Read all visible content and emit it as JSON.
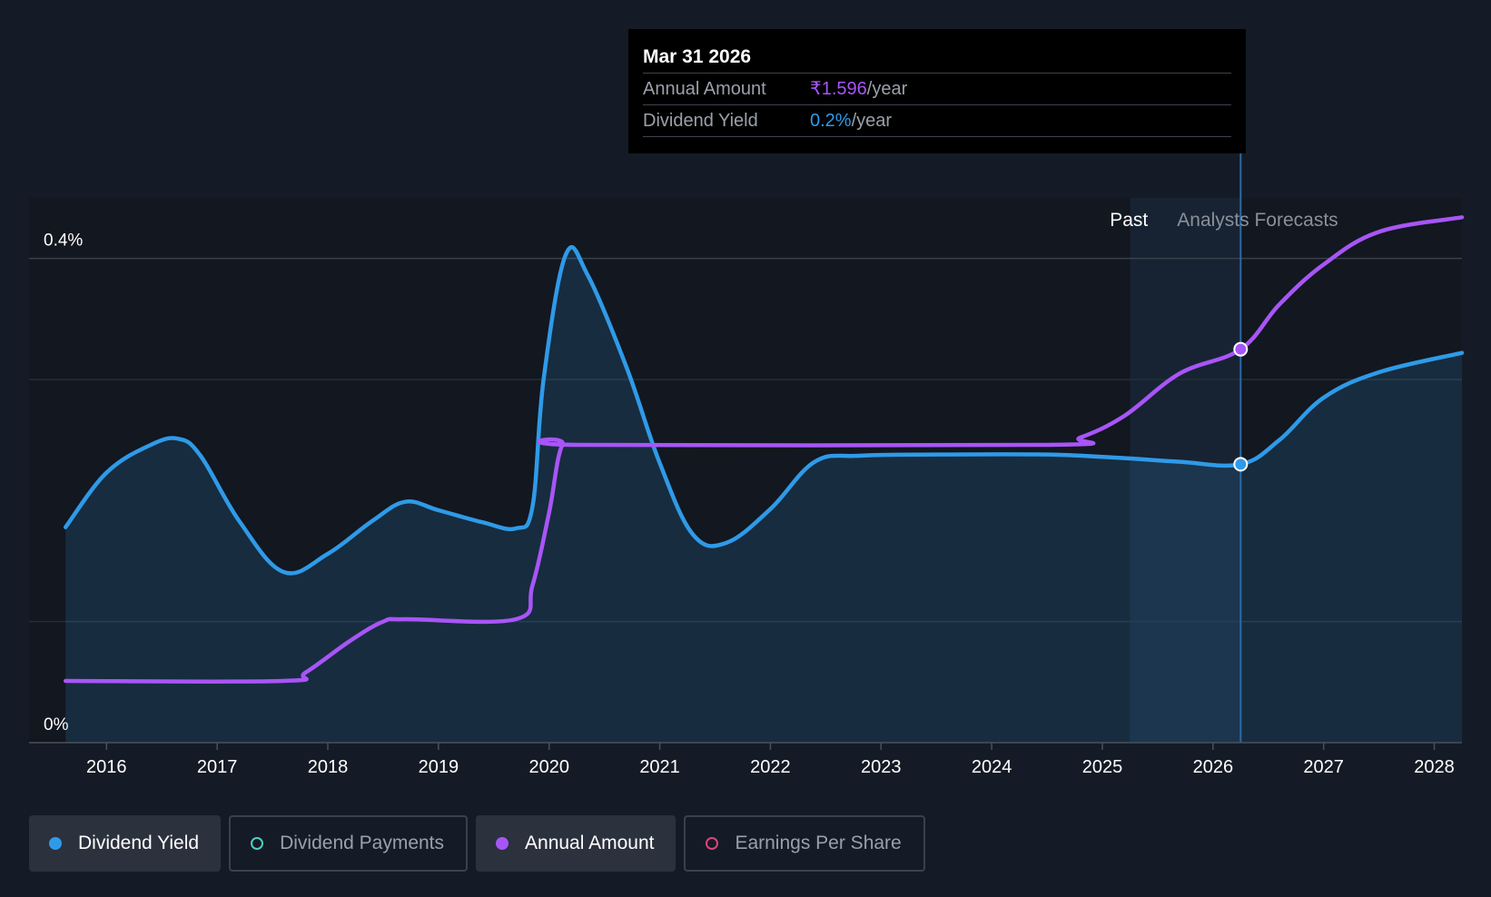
{
  "tooltip": {
    "date": "Mar 31 2026",
    "rows": [
      {
        "label": "Annual Amount",
        "value": "₹1.596",
        "unit": "/year"
      },
      {
        "label": "Dividend Yield",
        "value": "0.2%",
        "unit": "/year"
      }
    ]
  },
  "legend": [
    {
      "label": "Dividend Yield",
      "color": "#2f9ae8",
      "filled": true,
      "active": true
    },
    {
      "label": "Dividend Payments",
      "color": "#4ecdc4",
      "filled": false,
      "active": false
    },
    {
      "label": "Annual Amount",
      "color": "#a855f7",
      "filled": true,
      "active": true
    },
    {
      "label": "Earnings Per Share",
      "color": "#d9467a",
      "filled": false,
      "active": false
    }
  ],
  "chart_data": {
    "type": "line",
    "y_tick_labels": [
      "0%",
      "0.4%"
    ],
    "ylim": [
      0,
      0.45
    ],
    "xlim": [
      2015.3,
      2028.25
    ],
    "x_tick_labels": [
      "2016",
      "2017",
      "2018",
      "2019",
      "2020",
      "2021",
      "2022",
      "2023",
      "2024",
      "2025",
      "2026",
      "2027",
      "2028"
    ],
    "x_ticks": [
      2016,
      2017,
      2018,
      2019,
      2020,
      2021,
      2022,
      2023,
      2024,
      2025,
      2026,
      2027,
      2028
    ],
    "grid": true,
    "regions": [
      {
        "label": "Past",
        "from": 2025.25,
        "to": 2026.25
      },
      {
        "label": "Analysts Forecasts",
        "from": 2026.25,
        "to": 2028.25
      }
    ],
    "highlight_x": 2026.25,
    "series": [
      {
        "name": "Dividend Yield",
        "color": "#2f9ae8",
        "fill": true,
        "points": [
          [
            2015.63,
            0.178
          ],
          [
            2016.0,
            0.223
          ],
          [
            2016.4,
            0.246
          ],
          [
            2016.65,
            0.251
          ],
          [
            2016.85,
            0.237
          ],
          [
            2017.2,
            0.183
          ],
          [
            2017.6,
            0.141
          ],
          [
            2018.0,
            0.156
          ],
          [
            2018.4,
            0.183
          ],
          [
            2018.7,
            0.199
          ],
          [
            2019.0,
            0.192
          ],
          [
            2019.4,
            0.182
          ],
          [
            2019.7,
            0.177
          ],
          [
            2019.85,
            0.195
          ],
          [
            2019.95,
            0.3
          ],
          [
            2020.15,
            0.403
          ],
          [
            2020.35,
            0.386
          ],
          [
            2020.7,
            0.31
          ],
          [
            2021.0,
            0.231
          ],
          [
            2021.3,
            0.172
          ],
          [
            2021.6,
            0.165
          ],
          [
            2022.0,
            0.193
          ],
          [
            2022.4,
            0.232
          ],
          [
            2022.8,
            0.237
          ],
          [
            2023.5,
            0.238
          ],
          [
            2024.5,
            0.238
          ],
          [
            2025.2,
            0.235
          ],
          [
            2025.7,
            0.232
          ],
          [
            2026.25,
            0.23
          ],
          [
            2026.6,
            0.25
          ],
          [
            2027.0,
            0.285
          ],
          [
            2027.5,
            0.306
          ],
          [
            2028.25,
            0.322
          ]
        ]
      },
      {
        "name": "Annual Amount",
        "color": "#a855f7",
        "fill": false,
        "points": [
          [
            2015.63,
            0.051
          ],
          [
            2017.6,
            0.051
          ],
          [
            2017.8,
            0.058
          ],
          [
            2018.2,
            0.084
          ],
          [
            2018.5,
            0.1
          ],
          [
            2018.7,
            0.102
          ],
          [
            2019.7,
            0.102
          ],
          [
            2019.85,
            0.13
          ],
          [
            2020.0,
            0.19
          ],
          [
            2020.12,
            0.246
          ],
          [
            2020.3,
            0.246
          ],
          [
            2024.5,
            0.246
          ],
          [
            2024.8,
            0.252
          ],
          [
            2025.2,
            0.27
          ],
          [
            2025.7,
            0.305
          ],
          [
            2026.25,
            0.325
          ],
          [
            2026.6,
            0.362
          ],
          [
            2027.0,
            0.395
          ],
          [
            2027.5,
            0.422
          ],
          [
            2028.25,
            0.434
          ]
        ]
      }
    ]
  }
}
